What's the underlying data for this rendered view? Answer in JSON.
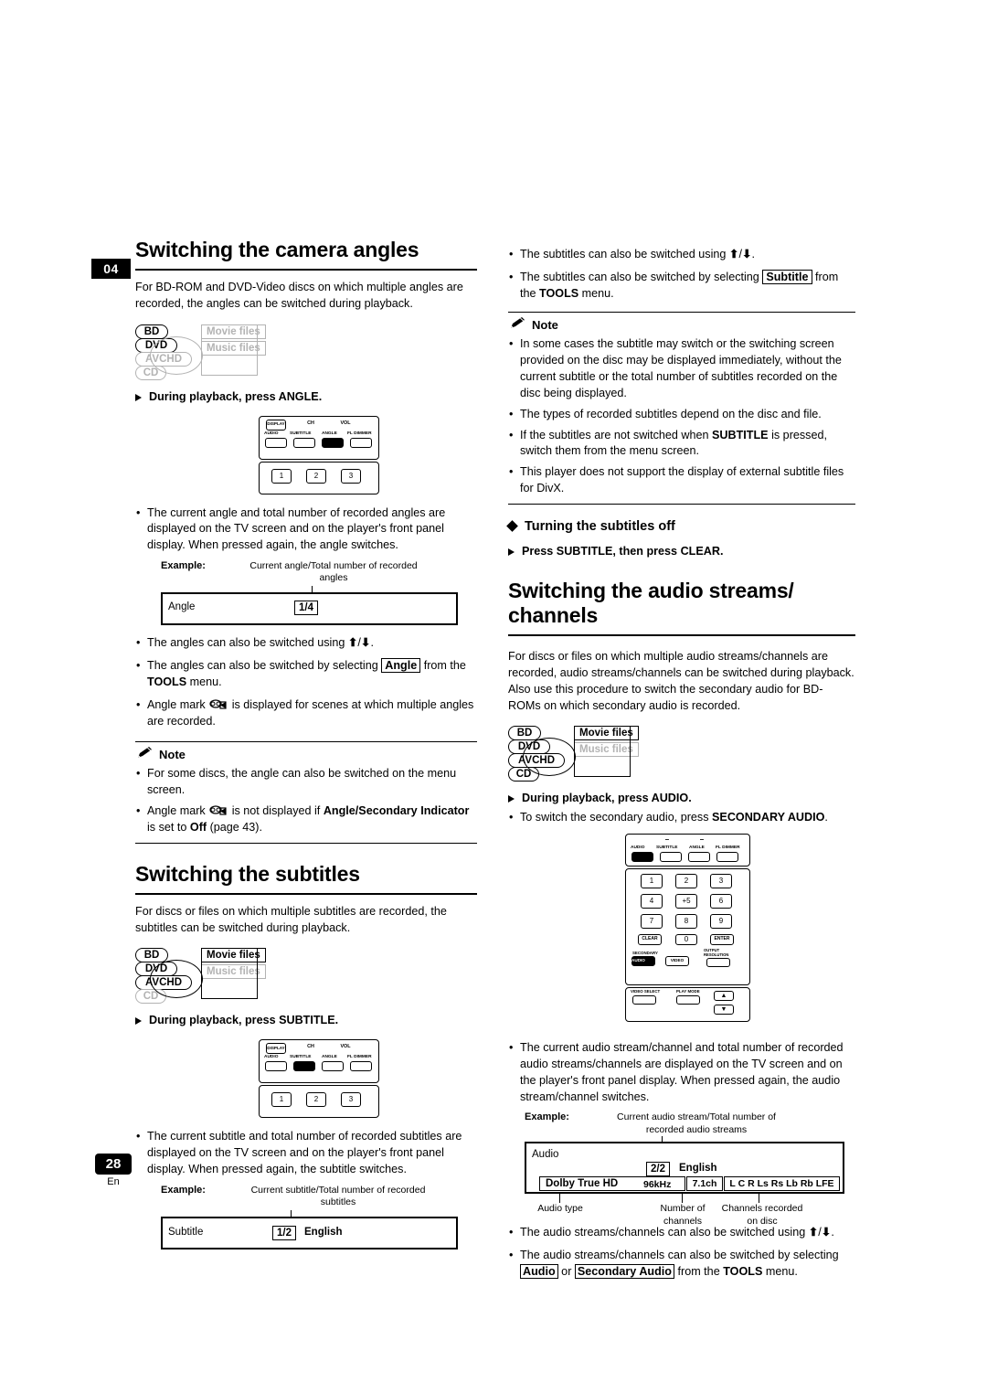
{
  "page": {
    "chapter_tab": "04",
    "page_number": "28",
    "language_code": "En"
  },
  "left_column": {
    "section1": {
      "title": "Switching the camera angles",
      "intro": "For BD-ROM and DVD-Video discs on which multiple angles are recorded, the angles can be switched during playback.",
      "discs": {
        "bd": "BD",
        "dvd": "DVD",
        "avchd": "AVCHD",
        "cd": "CD",
        "movie_files": "Movie files",
        "music_files": "Music files"
      },
      "step": "During playback, press ANGLE.",
      "bullets": [
        "The current angle and total number of recorded angles are displayed on the TV screen and on the player's front panel display. When pressed again, the angle switches."
      ],
      "example": {
        "label": "Example:",
        "caption": "Current angle/Total number of recorded angles",
        "field_label": "Angle",
        "value": "1/4"
      },
      "bullets2": [
        "The angles can also be switched using ↑/↓.",
        "The angles can also be switched by selecting Angle from the TOOLS menu.",
        "Angle mark  is displayed for scenes at which multiple angles are recorded."
      ],
      "note": {
        "head": "Note",
        "items": [
          "For some discs, the angle can also be switched on the menu screen.",
          "Angle mark  is not displayed if Angle/Secondary Indicator is set to Off (page 43)."
        ]
      }
    },
    "section2": {
      "title": "Switching the subtitles",
      "intro": "For discs or files on which multiple subtitles are recorded, the subtitles can be switched during playback.",
      "discs": {
        "bd": "BD",
        "dvd": "DVD",
        "avchd": "AVCHD",
        "cd": "CD",
        "movie_files": "Movie files",
        "music_files": "Music files"
      },
      "step": "During playback, press SUBTITLE.",
      "bullets": [
        "The current subtitle and total number of recorded subtitles are displayed on the TV screen and on the player's front panel display. When pressed again, the subtitle switches."
      ],
      "example": {
        "label": "Example:",
        "caption": "Current subtitle/Total number of recorded subtitles",
        "field_label": "Subtitle",
        "value": "1/2",
        "value2": "English"
      }
    },
    "remote_angle": {
      "row0": [
        "DISPLAY",
        "CH",
        "VOL"
      ],
      "row1": [
        "AUDIO",
        "SUBTITLE",
        "ANGLE",
        "FL DIMMER"
      ],
      "row2": [
        "1",
        "2",
        "3"
      ],
      "highlight": "ANGLE"
    },
    "remote_subtitle": {
      "row0": [
        "DISPLAY",
        "CH",
        "VOL"
      ],
      "row1": [
        "AUDIO",
        "SUBTITLE",
        "ANGLE",
        "FL DIMMER"
      ],
      "row2": [
        "1",
        "2",
        "3"
      ],
      "highlight": "SUBTITLE"
    }
  },
  "right_column": {
    "top_bullets": [
      "The subtitles can also be switched using ↑/↓.",
      "The subtitles can also be switched by selecting Subtitle from the TOOLS menu."
    ],
    "note": {
      "head": "Note",
      "items": [
        "In some cases the subtitle may switch or the switching screen provided on the disc may be displayed immediately, without the current subtitle or the total number of subtitles recorded on the disc being displayed.",
        "The types of recorded subtitles depend on the disc and file.",
        "If the subtitles are not switched when SUBTITLE is pressed, switch them from the menu screen.",
        "This player does not support the display of external subtitle files for DivX."
      ]
    },
    "subhead": "Turning the subtitles off",
    "step_clear": "Press SUBTITLE, then press CLEAR.",
    "section3": {
      "title": "Switching the audio streams/ channels",
      "intro": "For discs or files on which multiple audio streams/channels are recorded, audio streams/channels can be switched during playback. Also use this procedure to switch the secondary audio for BD-ROMs on which secondary audio is recorded.",
      "discs": {
        "bd": "BD",
        "dvd": "DVD",
        "avchd": "AVCHD",
        "cd": "CD",
        "movie_files": "Movie files",
        "music_files": "Music files"
      },
      "step": "During playback, press AUDIO.",
      "bullet_secondary": "To switch the secondary audio, press SECONDARY AUDIO.",
      "bullets": [
        "The current audio stream/channel and total number of recorded audio streams/channels are displayed on the TV screen and on the player's front panel display. When pressed again, the audio stream/channel switches."
      ],
      "example": {
        "label": "Example:",
        "caption": "Current audio stream/Total number of recorded audio streams",
        "field_label": "Audio",
        "value": "2/2",
        "language": "English",
        "format": "Dolby True HD",
        "samplerate": "96kHz",
        "channels": "7.1ch",
        "speakers": "L C R Ls Rs Lb Rb LFE",
        "cap_audio_type": "Audio type",
        "cap_number_channels": "Number of channels",
        "cap_channels_recorded": "Channels recorded on disc"
      },
      "bullets2": [
        "The audio streams/channels can also be switched using ↑/↓.",
        "The audio streams/channels can also be switched by selecting Audio or Secondary Audio from the TOOLS menu."
      ]
    },
    "remote_audio": {
      "row1": [
        "AUDIO",
        "SUBTITLE",
        "ANGLE",
        "FL DIMMER"
      ],
      "numbers": [
        "1",
        "2",
        "3",
        "4",
        "+5",
        "6",
        "7",
        "8",
        "9",
        "CLEAR",
        "0",
        "ENTER"
      ],
      "secondary_label": "SECONDARY",
      "secondary_audio": "AUDIO",
      "secondary_video": "VIDEO",
      "output_resolution": "OUTPUT RESOLUTION",
      "video_select": "VIDEO SELECT",
      "play_mode": "PLAY MODE",
      "highlight": "AUDIO"
    }
  }
}
